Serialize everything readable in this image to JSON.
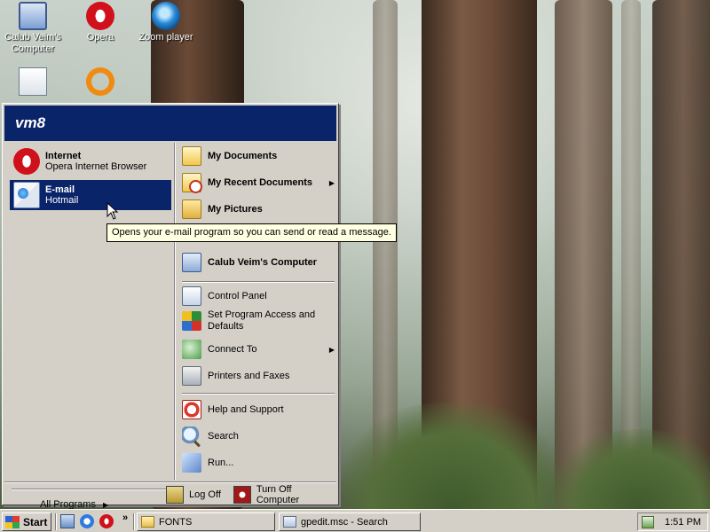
{
  "desktop": {
    "icons": [
      {
        "label": "Calub Veim's Computer",
        "icon": "my-computer-icon"
      },
      {
        "label": "Opera",
        "icon": "opera-icon"
      },
      {
        "label": "Zoom player",
        "icon": "zoom-player-icon"
      },
      {
        "label": "",
        "icon": "notepad-icon"
      },
      {
        "label": "",
        "icon": "orange-ring-icon"
      }
    ]
  },
  "start_menu": {
    "user": "vm8",
    "pinned": [
      {
        "title": "Internet",
        "subtitle": "Opera Internet Browser",
        "icon": "opera-icon"
      },
      {
        "title": "E-mail",
        "subtitle": "Hotmail",
        "icon": "email-icon",
        "selected": true
      }
    ],
    "all_programs": "All Programs",
    "right": [
      {
        "label": "My Documents",
        "icon": "my-documents-icon"
      },
      {
        "label": "My Recent Documents",
        "icon": "recent-documents-icon",
        "submenu": true
      },
      {
        "label": "My Pictures",
        "icon": "my-pictures-icon"
      },
      {
        "label": "Calub Veim's Computer",
        "icon": "my-computer-icon"
      },
      {
        "label": "Control Panel",
        "icon": "control-panel-icon"
      },
      {
        "label": "Set Program Access and Defaults",
        "icon": "set-program-access-icon"
      },
      {
        "label": "Connect To",
        "icon": "connect-to-icon",
        "submenu": true
      },
      {
        "label": "Printers and Faxes",
        "icon": "printer-icon"
      },
      {
        "label": "Help and Support",
        "icon": "help-icon"
      },
      {
        "label": "Search",
        "icon": "search-icon"
      },
      {
        "label": "Run...",
        "icon": "run-icon"
      }
    ],
    "log_off": "Log Off",
    "turn_off": "Turn Off Computer"
  },
  "tooltip": "Opens your e-mail program so you can send or read a message.",
  "taskbar": {
    "start": "Start",
    "quick_launch": [
      "show-desktop-icon",
      "internet-explorer-icon",
      "opera-icon"
    ],
    "chevron": "»",
    "windows": [
      {
        "label": "FONTS",
        "icon": "folder-icon"
      },
      {
        "label": "gpedit.msc - Search",
        "icon": "search-window-icon"
      }
    ],
    "clock": "1:51 PM"
  },
  "colors": {
    "menu_header": "#0a246a",
    "menu_face": "#d4d0c8",
    "selection": "#0a246a",
    "tooltip_bg": "#ffffe1"
  }
}
